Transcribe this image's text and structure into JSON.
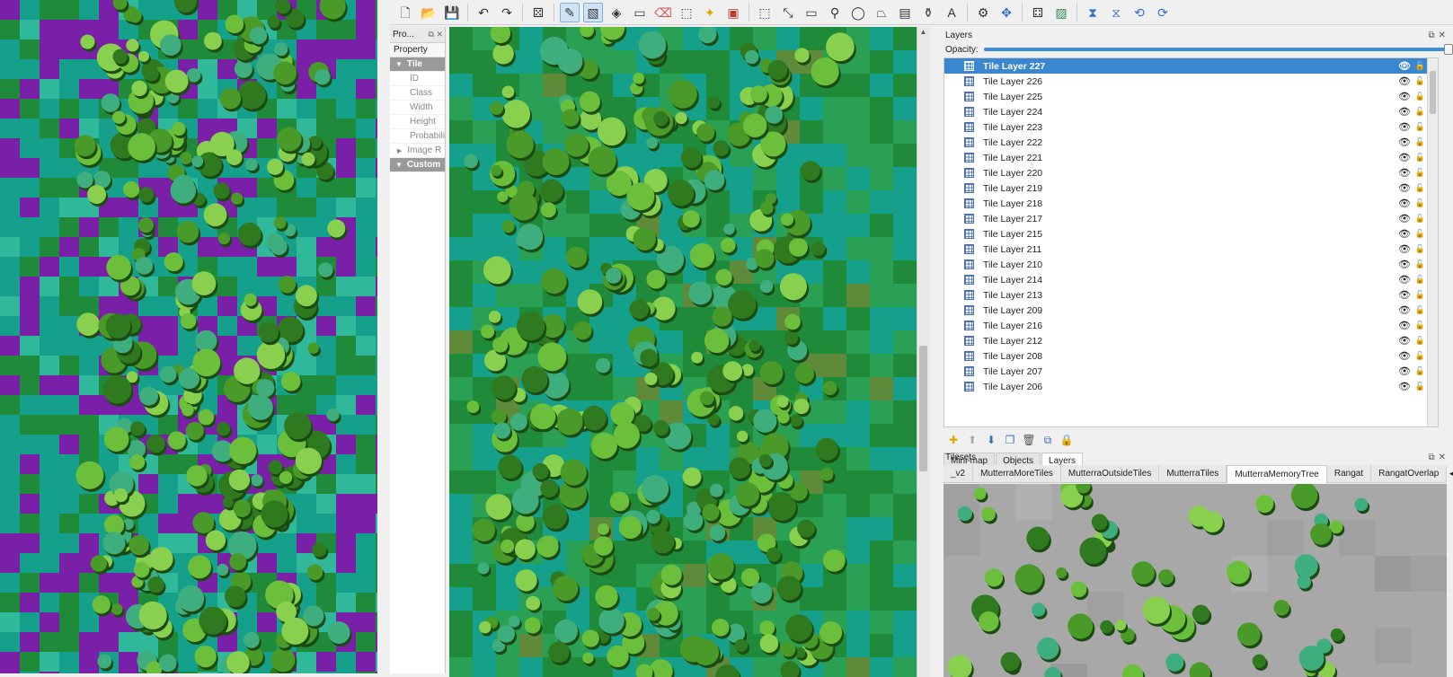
{
  "toolbar": {
    "buttons": [
      {
        "name": "new-map",
        "glyph": "🗋"
      },
      {
        "name": "open",
        "glyph": "📂"
      },
      {
        "name": "save",
        "glyph": "💾"
      },
      {
        "name": "undo",
        "glyph": "↶"
      },
      {
        "name": "redo",
        "glyph": "↷"
      },
      {
        "name": "random-mode",
        "glyph": "⚄"
      },
      {
        "name": "stamp-brush",
        "glyph": "✎"
      },
      {
        "name": "terrain-brush",
        "glyph": "▧"
      },
      {
        "name": "bucket-fill",
        "glyph": "◈"
      },
      {
        "name": "shape-fill",
        "glyph": "▭"
      },
      {
        "name": "eraser",
        "glyph": "⌫"
      },
      {
        "name": "rect-select",
        "glyph": "⬚"
      },
      {
        "name": "magic-wand",
        "glyph": "✦"
      },
      {
        "name": "select-same-tile",
        "glyph": "▣"
      }
    ]
  },
  "properties": {
    "title": "Pro...",
    "column_header": "Property",
    "group_tile": "Tile",
    "fields": [
      "ID",
      "Class",
      "Width",
      "Height",
      "Probabili"
    ],
    "image_row": "Image R",
    "group_custom": "Custom"
  },
  "layers_dock": {
    "title": "Layers",
    "opacity_label": "Opacity:",
    "opacity_value": 100,
    "layers": [
      "Tile Layer 227",
      "Tile Layer 226",
      "Tile Layer 225",
      "Tile Layer 224",
      "Tile Layer 223",
      "Tile Layer 222",
      "Tile Layer 221",
      "Tile Layer 220",
      "Tile Layer 219",
      "Tile Layer 218",
      "Tile Layer 217",
      "Tile Layer 215",
      "Tile Layer 211",
      "Tile Layer 210",
      "Tile Layer 214",
      "Tile Layer 213",
      "Tile Layer 209",
      "Tile Layer 216",
      "Tile Layer 212",
      "Tile Layer 208",
      "Tile Layer 207",
      "Tile Layer 206"
    ],
    "selected_index": 0,
    "tabs": [
      "Mini-map",
      "Objects",
      "Layers"
    ],
    "active_tab": "Layers"
  },
  "tilesets_dock": {
    "title": "Tilesets",
    "tabs": [
      "_v2",
      "MutterraMoreTiles",
      "MutterraOutsideTiles",
      "MutterraTiles",
      "MutterraMemoryTree",
      "Rangat",
      "RangatOverlap"
    ],
    "active_tab": "MutterraMemoryTree"
  },
  "colors": {
    "accent": "#3a87d0",
    "purple": "#7a1fa8",
    "grass": "#1f8a3a",
    "teal": "#14a08a",
    "tree": "#5db83a"
  }
}
